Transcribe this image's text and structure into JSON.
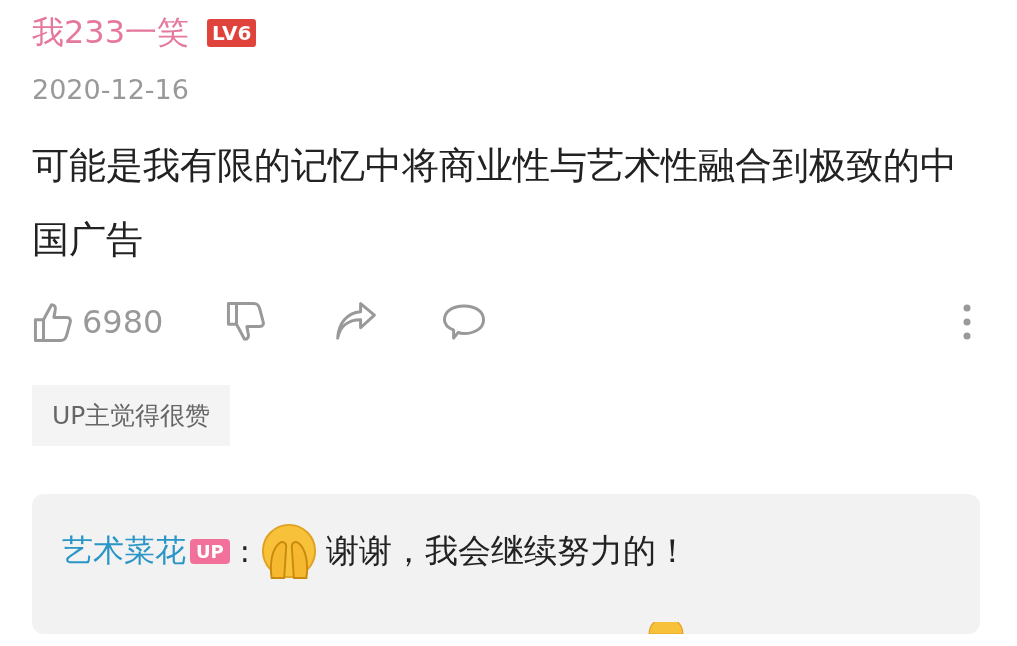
{
  "comment": {
    "user": "我233一笑",
    "level": "LV6",
    "date": "2020-12-16",
    "content": "可能是我有限的记忆中将商业性与艺术性融合到极致的中国广告",
    "likes": "6980",
    "tag": "UP主觉得很赞"
  },
  "reply": {
    "user": "艺术菜花",
    "badge": "UP",
    "separator": ":",
    "text": "谢谢，我会继续努力的！"
  }
}
